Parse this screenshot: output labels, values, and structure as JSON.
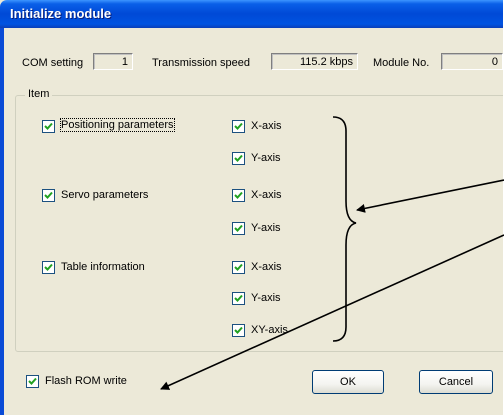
{
  "window": {
    "title": "Initialize module"
  },
  "settings": {
    "com_label": "COM setting",
    "com_value": "1",
    "speed_label": "Transmission speed",
    "speed_value": "115.2 kbps",
    "module_label": "Module No.",
    "module_value": "0"
  },
  "item_group": {
    "title": "Item",
    "rows": [
      {
        "label": "Positioning parameters",
        "checked": true,
        "axes": [
          {
            "label": "X-axis",
            "checked": true
          },
          {
            "label": "Y-axis",
            "checked": true
          }
        ]
      },
      {
        "label": "Servo parameters",
        "checked": true,
        "axes": [
          {
            "label": "X-axis",
            "checked": true
          },
          {
            "label": "Y-axis",
            "checked": true
          }
        ]
      },
      {
        "label": "Table information",
        "checked": true,
        "axes": [
          {
            "label": "X-axis",
            "checked": true
          },
          {
            "label": "Y-axis",
            "checked": true
          },
          {
            "label": "XY-axis",
            "checked": true
          }
        ]
      }
    ]
  },
  "footer": {
    "flash_label": "Flash ROM write",
    "flash_checked": true,
    "ok_label": "OK",
    "cancel_label": "Cancel"
  }
}
